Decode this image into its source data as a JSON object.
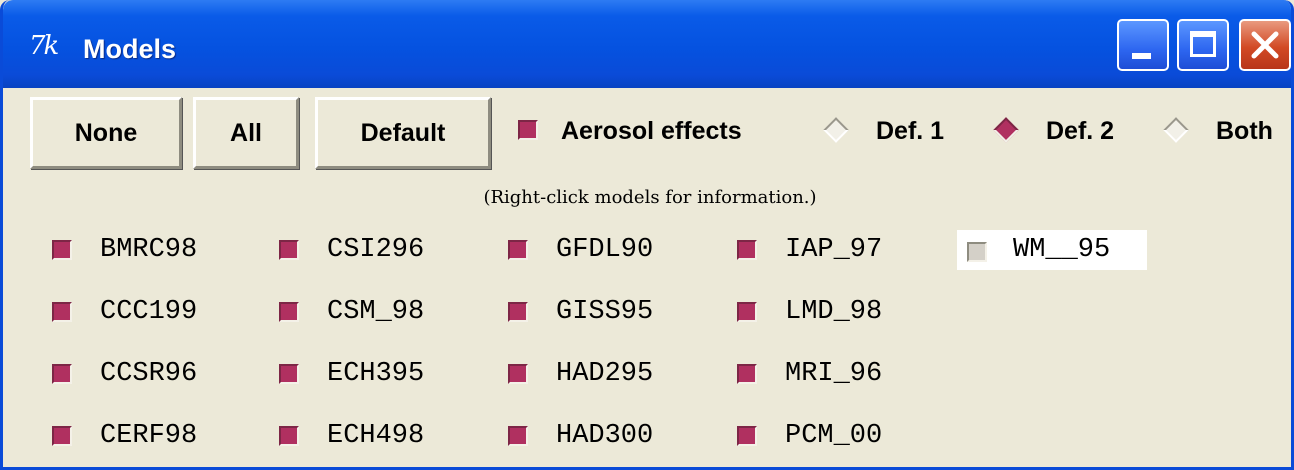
{
  "window": {
    "app_icon_text": "7k",
    "title": "Models"
  },
  "titlebar_buttons": {
    "minimize_icon": "minimize-icon",
    "maximize_icon": "maximize-icon",
    "close_icon": "close-icon"
  },
  "toolbar": {
    "none_label": "None",
    "all_label": "All",
    "default_label": "Default",
    "aerosol_label": "Aerosol effects",
    "aerosol_checked": true,
    "def1_label": "Def. 1",
    "def2_label": "Def. 2",
    "both_label": "Both",
    "selected_option": "Def. 2"
  },
  "hint": "(Right-click models for information.)",
  "models": {
    "col1": [
      {
        "name": "BMRC98",
        "checked": true
      },
      {
        "name": "CCC199",
        "checked": true
      },
      {
        "name": "CCSR96",
        "checked": true
      },
      {
        "name": "CERF98",
        "checked": true
      }
    ],
    "col2": [
      {
        "name": "CSI296",
        "checked": true
      },
      {
        "name": "CSM_98",
        "checked": true
      },
      {
        "name": "ECH395",
        "checked": true
      },
      {
        "name": "ECH498",
        "checked": true
      }
    ],
    "col3": [
      {
        "name": "GFDL90",
        "checked": true
      },
      {
        "name": "GISS95",
        "checked": true
      },
      {
        "name": "HAD295",
        "checked": true
      },
      {
        "name": "HAD300",
        "checked": true
      }
    ],
    "col4": [
      {
        "name": "IAP_97",
        "checked": true
      },
      {
        "name": "LMD_98",
        "checked": true
      },
      {
        "name": "MRI_96",
        "checked": true
      },
      {
        "name": "PCM_00",
        "checked": true
      }
    ],
    "col5": [
      {
        "name": "WM__95",
        "checked": false
      }
    ]
  },
  "colors": {
    "checked": "#B03060",
    "titlebar": "#0A4BD8",
    "background": "#ECE9D8"
  }
}
